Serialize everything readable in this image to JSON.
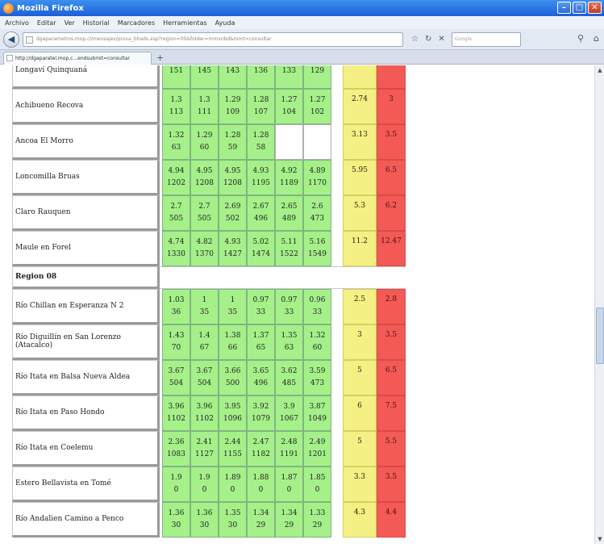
{
  "window": {
    "title": "Mozilla Firefox"
  },
  "menu": [
    "Archivo",
    "Editar",
    "Ver",
    "Historial",
    "Marcadores",
    "Herramientas",
    "Ayuda"
  ],
  "nav": {
    "url": "dgaparametros.mop.cl/mensajes/prova_bhads.asp?region=00&folder=rnmsnbd&mmt=consultar",
    "search_placeholder": "Google"
  },
  "tab": {
    "label": "http://dgaparatel.mop.c...endsubmit=consultar"
  },
  "rows": [
    {
      "type": "station",
      "name": "Longaví Quinquaná",
      "values": [
        [
          "151"
        ],
        [
          "145"
        ],
        [
          "143"
        ],
        [
          "136"
        ],
        [
          "133"
        ],
        [
          "129"
        ]
      ],
      "yellow": "",
      "red": ""
    },
    {
      "type": "station",
      "name": "Achibueno Recova",
      "values": [
        [
          "1.3",
          "113"
        ],
        [
          "1.3",
          "111"
        ],
        [
          "1.29",
          "109"
        ],
        [
          "1.28",
          "107"
        ],
        [
          "1.27",
          "104"
        ],
        [
          "1.27",
          "102"
        ]
      ],
      "yellow": "2.74",
      "red": "3"
    },
    {
      "type": "station",
      "name": "Ancoa El Morro",
      "values": [
        [
          "1.32",
          "63"
        ],
        [
          "1.29",
          "60"
        ],
        [
          "1.28",
          "59"
        ],
        [
          "1.28",
          "58"
        ],
        [],
        []
      ],
      "yellow": "3.13",
      "red": "3.5"
    },
    {
      "type": "station",
      "name": "Loncomilla Bruas",
      "values": [
        [
          "4.94",
          "1202"
        ],
        [
          "4.95",
          "1208"
        ],
        [
          "4.95",
          "1208"
        ],
        [
          "4.93",
          "1195"
        ],
        [
          "4.92",
          "1189"
        ],
        [
          "4.89",
          "1170"
        ]
      ],
      "yellow": "5.95",
      "red": "6.5"
    },
    {
      "type": "station",
      "name": "Claro Rauquen",
      "values": [
        [
          "2.7",
          "505"
        ],
        [
          "2.7",
          "505"
        ],
        [
          "2.69",
          "502"
        ],
        [
          "2.67",
          "496"
        ],
        [
          "2.65",
          "489"
        ],
        [
          "2.6",
          "473"
        ]
      ],
      "yellow": "5.3",
      "red": "6.2"
    },
    {
      "type": "station",
      "name": "Maule en Forel",
      "values": [
        [
          "4.74",
          "1330"
        ],
        [
          "4.82",
          "1370"
        ],
        [
          "4.93",
          "1427"
        ],
        [
          "5.02",
          "1474"
        ],
        [
          "5.11",
          "1522"
        ],
        [
          "5.16",
          "1549"
        ]
      ],
      "yellow": "11.2",
      "red": "12.47"
    },
    {
      "type": "region",
      "name": "Region 08"
    },
    {
      "type": "station",
      "name": "Río Chillan en Esperanza N 2",
      "values": [
        [
          "1.03",
          "36"
        ],
        [
          "1",
          "35"
        ],
        [
          "1",
          "35"
        ],
        [
          "0.97",
          "33"
        ],
        [
          "0.97",
          "33"
        ],
        [
          "0.96",
          "33"
        ]
      ],
      "yellow": "2.5",
      "red": "2.8"
    },
    {
      "type": "station",
      "name": "Río Diguillín en San Lorenzo (Atacalco)",
      "values": [
        [
          "1.43",
          "70"
        ],
        [
          "1.4",
          "67"
        ],
        [
          "1.38",
          "66"
        ],
        [
          "1.37",
          "65"
        ],
        [
          "1.35",
          "63"
        ],
        [
          "1.32",
          "60"
        ]
      ],
      "yellow": "3",
      "red": "3.5"
    },
    {
      "type": "station",
      "name": "Río Itata en Balsa Nueva Aldea",
      "values": [
        [
          "3.67",
          "504"
        ],
        [
          "3.67",
          "504"
        ],
        [
          "3.66",
          "500"
        ],
        [
          "3.65",
          "496"
        ],
        [
          "3.62",
          "485"
        ],
        [
          "3.59",
          "473"
        ]
      ],
      "yellow": "5",
      "red": "6.5"
    },
    {
      "type": "station",
      "name": "Río Itata en Paso Hondo",
      "values": [
        [
          "3.96",
          "1102"
        ],
        [
          "3.96",
          "1102"
        ],
        [
          "3.95",
          "1096"
        ],
        [
          "3.92",
          "1079"
        ],
        [
          "3.9",
          "1067"
        ],
        [
          "3.87",
          "1049"
        ]
      ],
      "yellow": "6",
      "red": "7.5"
    },
    {
      "type": "station",
      "name": "Río Itata en Coelemu",
      "values": [
        [
          "2.36",
          "1083"
        ],
        [
          "2.41",
          "1127"
        ],
        [
          "2.44",
          "1155"
        ],
        [
          "2.47",
          "1182"
        ],
        [
          "2.48",
          "1191"
        ],
        [
          "2.49",
          "1201"
        ]
      ],
      "yellow": "5",
      "red": "5.5"
    },
    {
      "type": "station",
      "name": "Estero Bellavista en Tomé",
      "values": [
        [
          "1.9",
          "0"
        ],
        [
          "1.9",
          "0"
        ],
        [
          "1.89",
          "0"
        ],
        [
          "1.88",
          "0"
        ],
        [
          "1.87",
          "0"
        ],
        [
          "1.85",
          "0"
        ]
      ],
      "yellow": "3.3",
      "red": "3.5"
    },
    {
      "type": "station",
      "name": "Río Andalien Camino a Penco",
      "values": [
        [
          "1.36",
          "30"
        ],
        [
          "1.36",
          "30"
        ],
        [
          "1.35",
          "30"
        ],
        [
          "1.34",
          "29"
        ],
        [
          "1.34",
          "29"
        ],
        [
          "1.33",
          "29"
        ]
      ],
      "yellow": "4.3",
      "red": "4.4"
    }
  ]
}
